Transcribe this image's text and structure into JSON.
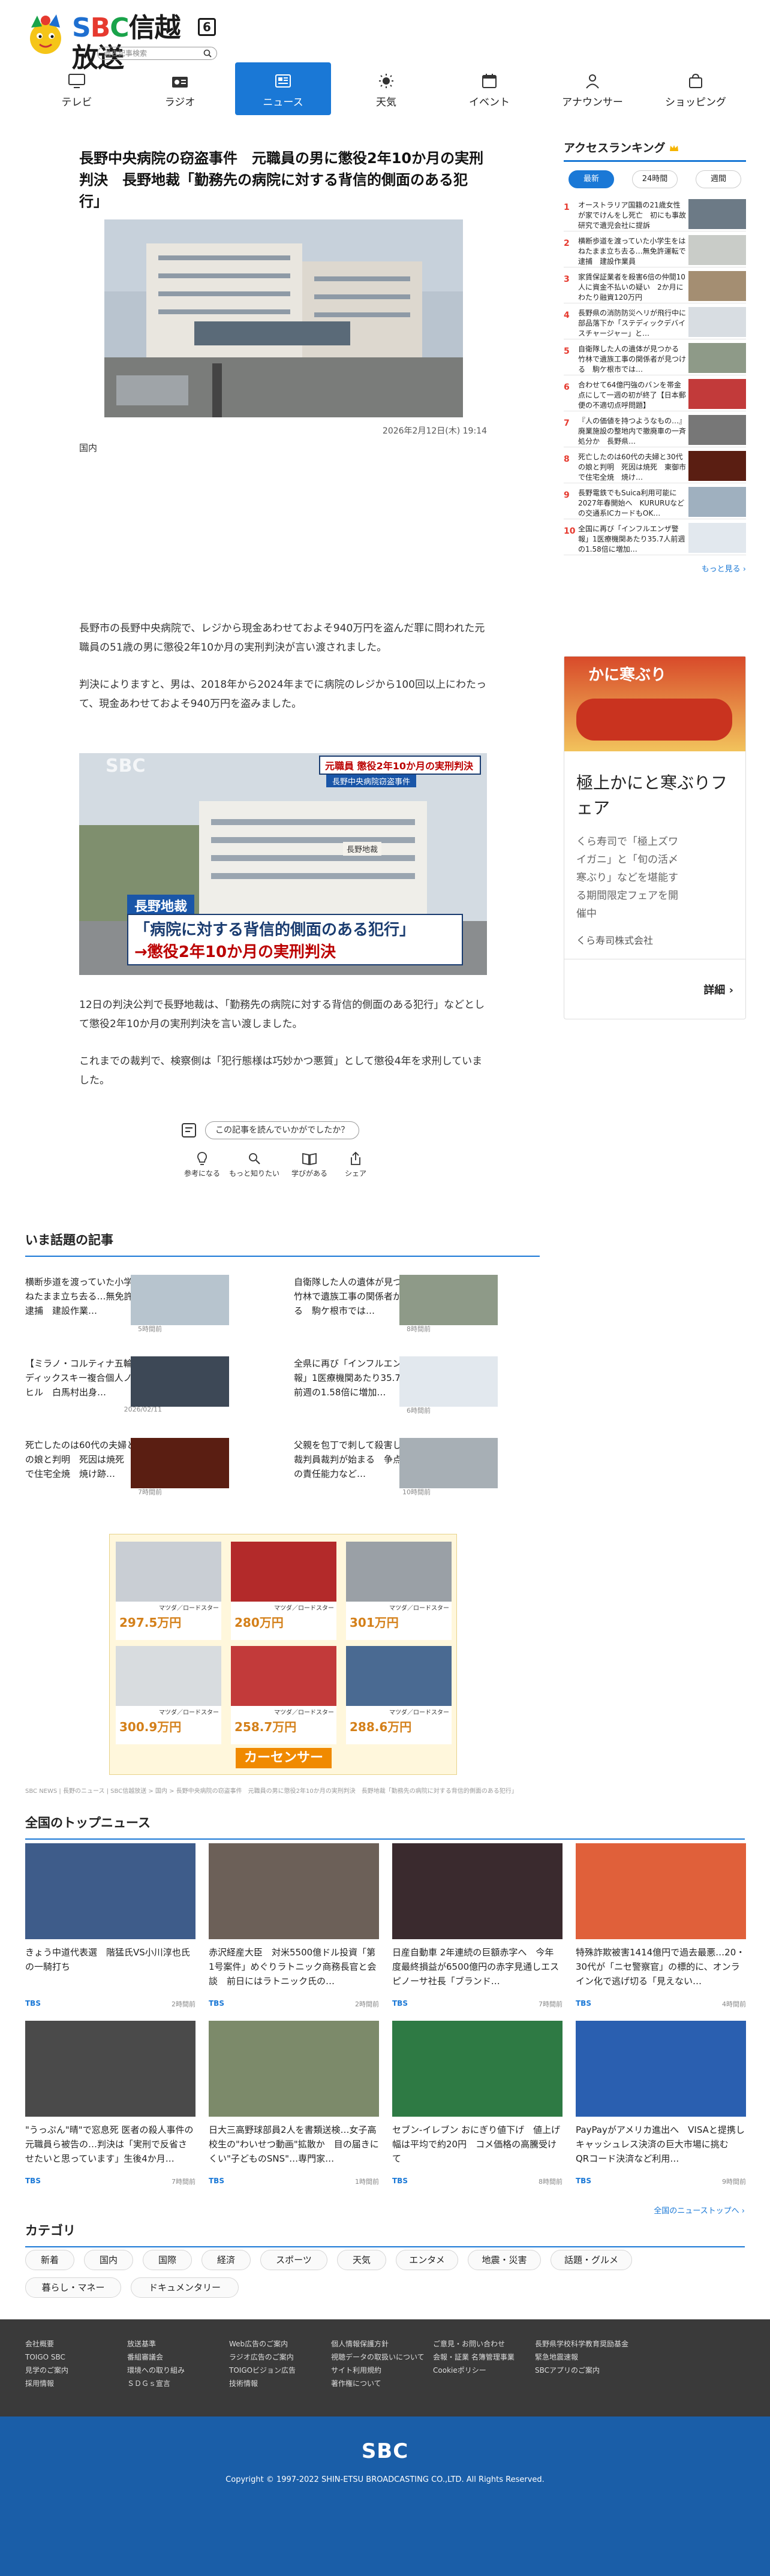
{
  "header": {
    "search_placeholder": "過去記事検索"
  },
  "nav": [
    {
      "label": "テレビ",
      "icon": "tv-icon"
    },
    {
      "label": "ラジオ",
      "icon": "radio-icon"
    },
    {
      "label": "ニュース",
      "icon": "news-icon"
    },
    {
      "label": "天気",
      "icon": "sun-icon"
    },
    {
      "label": "イベント",
      "icon": "calendar-icon"
    },
    {
      "label": "アナウンサー",
      "icon": "person-icon"
    },
    {
      "label": "ショッピング",
      "icon": "bag-icon"
    }
  ],
  "article": {
    "title": "長野中央病院の窃盗事件　元職員の男に懲役2年10か月の実刑判決　長野地裁「勤務先の病院に対する背信的側面のある犯行」",
    "date": "2026年2月12日(木) 19:14",
    "category": "国内",
    "p1": "長野市の長野中央病院で、レジから現金あわせておよそ940万円を盗んだ罪に問われた元職員の51歳の男に懲役2年10か月の実刑判決が言い渡されました。",
    "p2": "判決によりますと、男は、2018年から2024年までに病院のレジから100回以上にわたって、現金あわせておよそ940万円を盗みました。",
    "img2_caption_top": "元職員 懲役2年10か月の実刑判決",
    "img2_caption_sub": "長野中央病院窃盗事件",
    "img2_place": "長野地裁",
    "img2_line1": "「病院に対する背信的側面のある犯行」",
    "img2_line2": "→懲役2年10か月の実刑判決",
    "img2_logo": "SBC",
    "img2_building": "長野地裁",
    "p3": "12日の判決公判で長野地裁は、「勤務先の病院に対する背信的側面のある犯行」などとして懲役2年10か月の実刑判決を言い渡しました。",
    "p4": "これまでの裁判で、検察側は「犯行態様は巧妙かつ悪質」として懲役4年を求刑していました。",
    "feedback_q": "この記事を読んでいかがでしたか？",
    "reactions": [
      "参考になる",
      "もっと知りたい",
      "学びがある",
      "シェア"
    ]
  },
  "ranking": {
    "title": "アクセスランキング",
    "tabs": [
      "最新",
      "24時間",
      "週間"
    ],
    "items": [
      {
        "n": "1",
        "t": "オーストラリア国籍の21歳女性が家でけんをし死亡　初にも事故研究で遺児会社に提訴"
      },
      {
        "n": "2",
        "t": "横断歩道を渡っていた小学生をはねたまま立ち去る…無免許運転で逮捕　建設作業員"
      },
      {
        "n": "3",
        "t": "家賃保証業者を殺害6倍の仲間10人に資金不払いの疑い　2か月にわたり融資120万円"
      },
      {
        "n": "4",
        "t": "長野県の消防防災ヘリが飛行中に部品落下か「ステディックデバイスチャージャー」と…"
      },
      {
        "n": "5",
        "t": "自衛隊した人の遺体が見つかる 竹林で遺族工事の関係者が見つける　駒ケ根市では…"
      },
      {
        "n": "6",
        "t": "合わせて64億円強のバンを帯金点にして一週の初が終了【日本郵便の不適切点呼問題】"
      },
      {
        "n": "7",
        "t": "『人の価値を持つようなもの…』廃業施設の整地内で撤廃車の一斉処分か　長野県…"
      },
      {
        "n": "8",
        "t": "死亡したのは60代の夫婦と30代の娘と判明　死因は焼死　東御市で住宅全焼　焼け…"
      },
      {
        "n": "9",
        "t": "長野電鉄でもSuica利用可能に2027年春開始へ　KURURUなどの交通系ICカードもOK…"
      },
      {
        "n": "10",
        "t": "全国に再び「インフルエンザ警報」1医療機関あたり35.7人前週の1.58倍に増加…"
      }
    ],
    "more": "もっと見る"
  },
  "ad": {
    "banner": "かに寒ぶり",
    "title": "極上かにと寒ぶりフェア",
    "desc": "くら寿司で「極上ズワイガニ」と「旬の活〆寒ぶり」などを堪能する期間限定フェアを開催中",
    "company": "くら寿司株式会社",
    "cta": "詳細"
  },
  "trending": {
    "title": "いま話題の記事",
    "items": [
      {
        "t": "横断歩道を渡っていた小学生をはねたまま立ち去る…無免許運転で逮捕　建設作業…",
        "d": "5時間前"
      },
      {
        "t": "自衛隊した人の遺体が見つかる　竹林で遺族工事の関係者が見つける　駒ケ根市では…",
        "d": "8時間前"
      },
      {
        "t": "【ミラノ・コルティナ五輪】ノルディックスキー複合個人ノーマルヒル　白馬村出身…",
        "d": "2026/02/11"
      },
      {
        "t": "全県に再び「インフルエンザ警報」1医療機関あたり35.7　6人　前週の1.58倍に増加…",
        "d": "6時間前"
      },
      {
        "t": "死亡したのは60代の夫婦と30代の娘と判明　死因は焼死　東御市で住宅全焼　焼け跡…",
        "d": "7時間前"
      },
      {
        "t": "父親を包丁で刺して殺害した女　裁判員裁判が始まる　争点は被告の責任能力など…",
        "d": "10時間前"
      }
    ]
  },
  "car_ad": {
    "items": [
      {
        "model": "マツダ／ロードスター",
        "price": "297.5万円"
      },
      {
        "model": "マツダ／ロードスター",
        "price": "280万円"
      },
      {
        "model": "マツダ／ロードスター",
        "price": "301万円"
      },
      {
        "model": "マツダ／ロードスター",
        "price": "300.9万円"
      },
      {
        "model": "マツダ／ロードスター",
        "price": "258.7万円"
      },
      {
        "model": "マツダ／ロードスター",
        "price": "288.6万円"
      }
    ],
    "brand": "カーセンサー"
  },
  "breadcrumb": "SBC NEWS | 長野のニュース | SBC信越放送 > 国内 > 長野中央病院の窃盗事件　元職員の男に懲役2年10か月の実刑判決　長野地裁「勤務先の病院に対する背信的側面のある犯行」",
  "topnews": {
    "title": "全国のトップニュース",
    "items": [
      {
        "t": "きょう中道代表選　階猛氏VS小川淳也氏の一騎打ち",
        "src": "TBS",
        "tm": "2時間前"
      },
      {
        "t": "赤沢経産大臣　対米5500億ドル投資「第1号案件」めぐりラトニック商務長官と会談　前日にはラトニック氏の…",
        "src": "TBS",
        "tm": "2時間前"
      },
      {
        "t": "日産自動車 2年連続の巨額赤字へ　今年度最終損益が6500億円の赤字見通しエスピノーサ社長「ブランド…",
        "src": "TBS",
        "tm": "7時間前"
      },
      {
        "t": "特殊詐欺被害1414億円で過去最悪…20・30代が「ニセ警察官」の標的に、オンライン化で逃げ切る「見えない…",
        "src": "TBS",
        "tm": "4時間前"
      },
      {
        "t": "\"うっぷん\"晴\"で窓息死 医者の殺人事件の元職員ら被告の…判決は「実刑で反省させたいと思っています」生後4か月…",
        "src": "TBS",
        "tm": "7時間前"
      },
      {
        "t": "日大三高野球部員2人を書類送検…女子高校生の\"わいせつ動画\"拡散か　目の届きにくい\"子どものSNS\"…専門家…",
        "src": "TBS",
        "tm": "1時間前"
      },
      {
        "t": "セブン-イレブン おにぎり値下げ　値上げ幅は平均で約20円　コメ価格の高騰受けて",
        "src": "TBS",
        "tm": "8時間前"
      },
      {
        "t": "PayPayがアメリカ進出へ　VISAと提携しキャッシュレス決済の巨大市場に挑む　QRコード決済など利用…",
        "src": "TBS",
        "tm": "9時間前"
      }
    ],
    "more": "全国のニューストップへ"
  },
  "categories": {
    "title": "カテゴリ",
    "items": [
      "新着",
      "国内",
      "国際",
      "経済",
      "スポーツ",
      "天気",
      "エンタメ",
      "地震・災害",
      "話題・グルメ",
      "暮らし・マネー",
      "ドキュメンタリー"
    ]
  },
  "footer": {
    "cols": [
      [
        "会社概要",
        "TOIGO SBC",
        "見学のご案内",
        "採用情報"
      ],
      [
        "放送基準",
        "番組審議会",
        "環境への取り組み",
        "ＳＤＧｓ宣言"
      ],
      [
        "Web広告のご案内",
        "ラジオ広告のご案内",
        "TOIGOビジョン広告",
        "技術情報"
      ],
      [
        "個人情報保護方針",
        "視聴データの取扱いについて",
        "サイト利用規約",
        "著作権について"
      ],
      [
        "ご意見・お問い合わせ",
        "会報・証業 名簿管理事業",
        "Cookieポリシー"
      ],
      [
        "長野県学校科学教育奨励基金",
        "緊急地震速報",
        "SBCアプリのご案内"
      ]
    ],
    "logo": "SBC",
    "copyright": "Copyright © 1997-2022 SHIN-ETSU BROADCASTING CO.,LTD. All Rights Reserved."
  }
}
